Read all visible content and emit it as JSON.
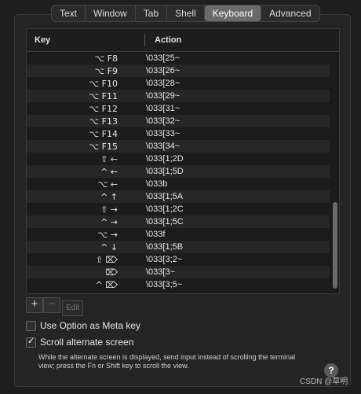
{
  "tabs": [
    {
      "label": "Text"
    },
    {
      "label": "Window"
    },
    {
      "label": "Tab"
    },
    {
      "label": "Shell"
    },
    {
      "label": "Keyboard"
    },
    {
      "label": "Advanced"
    }
  ],
  "table": {
    "columns": {
      "key": "Key",
      "action": "Action"
    },
    "rows": [
      {
        "key": "⌥ F8",
        "action": "\\033[25~"
      },
      {
        "key": "⌥ F9",
        "action": "\\033[26~"
      },
      {
        "key": "⌥ F10",
        "action": "\\033[28~"
      },
      {
        "key": "⌥ F11",
        "action": "\\033[29~"
      },
      {
        "key": "⌥ F12",
        "action": "\\033[31~"
      },
      {
        "key": "⌥ F13",
        "action": "\\033[32~"
      },
      {
        "key": "⌥ F14",
        "action": "\\033[33~"
      },
      {
        "key": "⌥ F15",
        "action": "\\033[34~"
      },
      {
        "key": "⇧ ←",
        "action": "\\033[1;2D"
      },
      {
        "key": "^ ←",
        "action": "\\033[1;5D"
      },
      {
        "key": "⌥ ←",
        "action": "\\033b"
      },
      {
        "key": "^ ↑",
        "action": "\\033[1;5A"
      },
      {
        "key": "⇧ →",
        "action": "\\033[1;2C"
      },
      {
        "key": "^ →",
        "action": "\\033[1;5C"
      },
      {
        "key": "⌥ →",
        "action": "\\033f"
      },
      {
        "key": "^ ↓",
        "action": "\\033[1;5B"
      },
      {
        "key": "⇧ ⌦",
        "action": "\\033[3;2~"
      },
      {
        "key": "⌦",
        "action": "\\033[3~"
      },
      {
        "key": "^ ⌦",
        "action": "\\033[3;5~"
      }
    ]
  },
  "buttons": {
    "add": "+",
    "remove": "−",
    "edit": "Edit"
  },
  "options": {
    "meta_key": {
      "label": "Use Option as Meta key",
      "checked": false
    },
    "scroll_alternate": {
      "label": "Scroll alternate screen",
      "checked": true
    }
  },
  "description": "While the alternate screen is displayed, send input instead of scrolling the terminal view; press the Fn or Shift key to scroll the view.",
  "help": "?",
  "watermark": "CSDN @草明"
}
